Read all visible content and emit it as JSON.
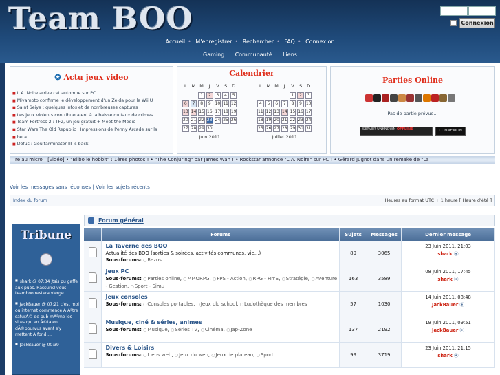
{
  "header": {
    "logo": "Team BOO",
    "login_button": "Connexion"
  },
  "nav": {
    "row1": [
      "Accueil",
      "M'enregistrer",
      "Rechercher",
      "FAQ",
      "Connexion"
    ],
    "row2": [
      "Gaming",
      "Communauté",
      "Liens"
    ]
  },
  "actu": {
    "title": "Actu jeux video",
    "items": [
      "L.A. Noire arrive cet automne sur PC",
      "Miyamoto confirme le développement d'un Zelda pour la Wii U",
      "Saint Seiya : quelques infos et de nombreuses captures",
      "Les jeux violents contribueraient à la baisse du taux de crimes",
      "Team Fortress 2 : TF2, un jeu gratuit + Meet the Medic",
      "Star Wars The Old Republic : Impressions de Penny Arcade sur la",
      "beta",
      "Dofus : Goultarminator III is back"
    ]
  },
  "calendar": {
    "title": "Calendrier",
    "days": [
      "L",
      "M",
      "M",
      "J",
      "V",
      "S",
      "D"
    ],
    "june_label": "Juin 2011",
    "july_label": "Juillet 2011"
  },
  "parties": {
    "title": "Parties Online",
    "empty": "Pas de partie prévue...",
    "server_text": "SERVER UNKNOWN",
    "server_status": "OFFLINE",
    "connexion": "CONNEXION"
  },
  "ticker": "re au micro ! [vidéo] • \"Bilbo le hobbit\" : 1ères photos ! • \"The Conjuring\" par James Wan ! • Rockstar annonce \"L.A. Noire\" sur PC ! • Gérard Jugnot dans un remake de \"La",
  "quicklinks": {
    "unanswered": "Voir les messages sans réponses",
    "recent": "Voir les sujets récents",
    "sep": " | "
  },
  "navbar": {
    "index": "Index du forum",
    "timezone": "Heures au format UTC + 1 heure [ Heure d'été ]"
  },
  "sidebar": {
    "logo": "Tribune",
    "shouts": [
      "shark @ 07:34 jtsis pu gaffe aux pubs. Rassurez vous teamboo restera vierge",
      "JackBauer @ 07:21 c'est moi ou internet commence Ã  Ãªtre saturÃ© de pub mÃªme les sites qui en Ã©taient dÃ©pourvus avant s'y mettent Ã  fond ...",
      "JackBauer @ 00:39"
    ]
  },
  "forum": {
    "section": "Forum général",
    "columns": [
      "Forums",
      "Sujets",
      "Messages",
      "Dernier message"
    ],
    "sub_label": "Sous-forums:",
    "rows": [
      {
        "title": "La Taverne des BOO",
        "desc": "Actualité des BOO (sorties & soirées, activités communes, vie...)",
        "subs": [
          "Rezos"
        ],
        "topics": "89",
        "posts": "3065",
        "date": "23 Juin 2011, 21:03",
        "user": "shark"
      },
      {
        "title": "Jeux PC",
        "desc": "",
        "subs": [
          "Parties online",
          "MMORPG",
          "FPS - Action",
          "RPG - Hn'S",
          "Stratégie",
          "Aventure - Gestion",
          "Sport - Simu"
        ],
        "topics": "163",
        "posts": "3589",
        "date": "08 Juin 2011, 17:45",
        "user": "shark"
      },
      {
        "title": "Jeux consoles",
        "desc": "",
        "subs": [
          "Consoles portables",
          "Jeux old school",
          "Ludothèque des membres"
        ],
        "topics": "57",
        "posts": "1030",
        "date": "14 Juin 2011, 08:48",
        "user": "JackBauer"
      },
      {
        "title": "Musique, ciné & séries, animes",
        "desc": "",
        "subs": [
          "Musique",
          "Séries TV",
          "Cinéma",
          "Jap-Zone"
        ],
        "topics": "137",
        "posts": "2192",
        "date": "19 Juin 2011, 09:51",
        "user": "JackBauer"
      },
      {
        "title": "Divers & Loisirs",
        "desc": "",
        "subs": [
          "Liens web",
          "Jeux du web",
          "Jeux de plateau",
          "Sport"
        ],
        "topics": "99",
        "posts": "3719",
        "date": "23 Juin 2011, 21:15",
        "user": "shark"
      }
    ]
  }
}
